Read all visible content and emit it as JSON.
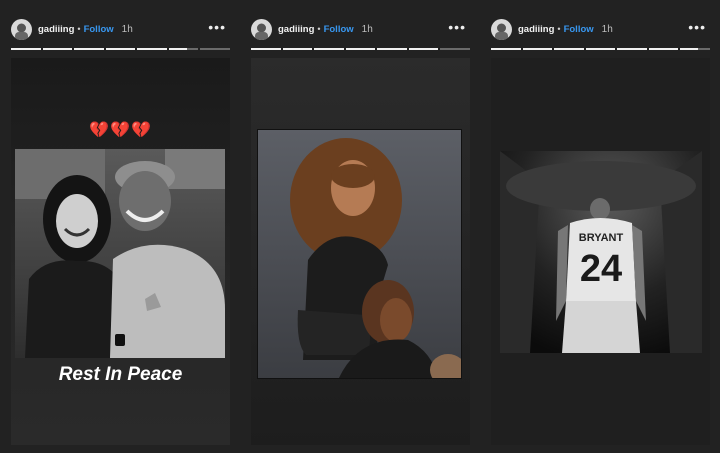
{
  "stories": [
    {
      "username": "gadiiing",
      "separator": "•",
      "follow_label": "Follow",
      "time": "1h",
      "more_icon": "more-horizontal-icon",
      "progress": [
        1,
        1,
        1,
        1,
        1,
        0.6,
        0
      ],
      "hearts": "💔💔💔",
      "caption": "Rest In Peace",
      "photo": "photo-father-daughter-courtside"
    },
    {
      "username": "gadiiing",
      "separator": "•",
      "follow_label": "Follow",
      "time": "1h",
      "more_icon": "more-horizontal-icon",
      "progress": [
        1,
        1,
        1,
        1,
        1,
        1,
        0
      ],
      "photo": "photo-girl-on-shoulders"
    },
    {
      "username": "gadiiing",
      "separator": "•",
      "follow_label": "Follow",
      "time": "1h",
      "more_icon": "more-horizontal-icon",
      "progress": [
        1,
        1,
        1,
        1,
        1,
        1,
        0.6
      ],
      "photo": "photo-bryant-24-jersey",
      "jersey_name": "BRYANT",
      "jersey_number": "24"
    }
  ]
}
